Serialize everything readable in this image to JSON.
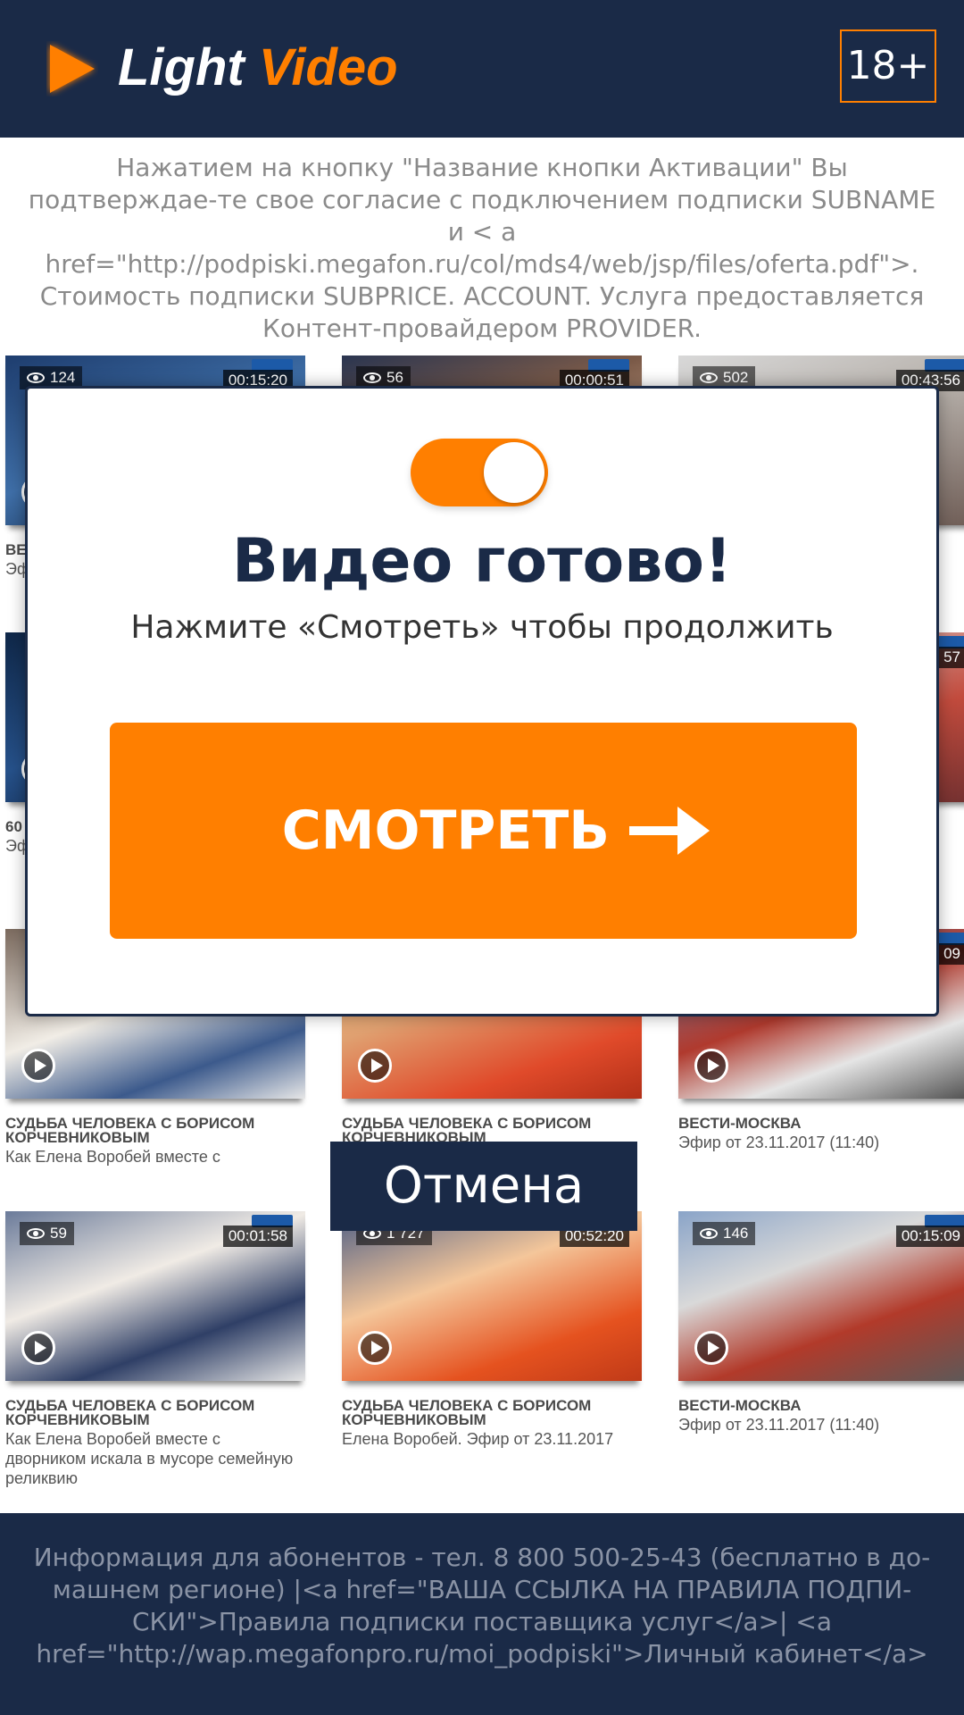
{
  "header": {
    "logo_light": "Light",
    "logo_video": "Video",
    "age_rating": "18+"
  },
  "disclaimer": "Нажатием на кнопку \"Название кнопки Активации\" Вы подтверждае-те свое согласие с подключением подписки SUBNAME и < a href=\"http://podpiski.megafon.ru/col/mds4/web/jsp/files/oferta.pdf\">. Стоимость подписки SUBPRICE. ACCOUNT. Услуга предоставляется Контент-провайдером PROVIDER.",
  "videos": [
    {
      "views": "124",
      "duration": "00:15:20",
      "title": "ВЕ",
      "desc": "Эф"
    },
    {
      "views": "56",
      "duration": "00:00:51",
      "title": "",
      "desc": ""
    },
    {
      "views": "502",
      "duration": "00:43:56",
      "title": "",
      "desc": ""
    },
    {
      "views": "",
      "duration": "",
      "title": "60",
      "desc": "Эф сл"
    },
    {
      "views": "",
      "duration": "",
      "title": "",
      "desc": ""
    },
    {
      "views": "",
      "duration": "57",
      "title": "",
      "desc": ""
    },
    {
      "views": "",
      "duration": "",
      "title": "СУДЬБА ЧЕЛОВЕКА С БОРИСОМ КОРЧЕВНИКОВЫМ",
      "desc": "Как Елена Воробей вместе с"
    },
    {
      "views": "",
      "duration": "",
      "title": "СУДЬБА ЧЕЛОВЕКА С БОРИСОМ КОРЧЕВНИКОВЫМ",
      "desc": ""
    },
    {
      "views": "",
      "duration": "09",
      "title": "ВЕСТИ-МОСКВА",
      "desc": "Эфир от 23.11.2017 (11:40)"
    },
    {
      "views": "59",
      "duration": "00:01:58",
      "title": "СУДЬБА ЧЕЛОВЕКА С БОРИСОМ КОРЧЕВНИКОВЫМ",
      "desc": "Как Елена Воробей вместе с дворником искала в мусоре семейную реликвию"
    },
    {
      "views": "1 727",
      "duration": "00:52:20",
      "title": "СУДЬБА ЧЕЛОВЕКА С БОРИСОМ КОРЧЕВНИКОВЫМ",
      "desc": "Елена Воробей. Эфир от 23.11.2017"
    },
    {
      "views": "146",
      "duration": "00:15:09",
      "title": "ВЕСТИ-МОСКВА",
      "desc": "Эфир от 23.11.2017 (11:40)"
    }
  ],
  "modal": {
    "title": "Видео готово!",
    "subtitle": "Нажмите «Смотреть» чтобы продолжить",
    "watch_label": "СМОТРЕТЬ",
    "toggle_on": true
  },
  "cancel_label": "Отмена",
  "footer": "Информация для абонентов - тел. 8 800 500-25-43 (бесплатно в до-машнем регионе) |<a href=\"ВАША ССЫЛКА НА ПРАВИЛА ПОДПИ-СКИ\">Правила подписки поставщика услуг</a>| <a href=\"http://wap.megafonpro.ru/moi_podpiski\">Личный кабинет</a>",
  "colors": {
    "navy": "#1a2a47",
    "accent": "#ff7f00",
    "icons": [
      "play-logo-icon",
      "eye-icon",
      "play-icon",
      "arrow-right-icon"
    ]
  }
}
